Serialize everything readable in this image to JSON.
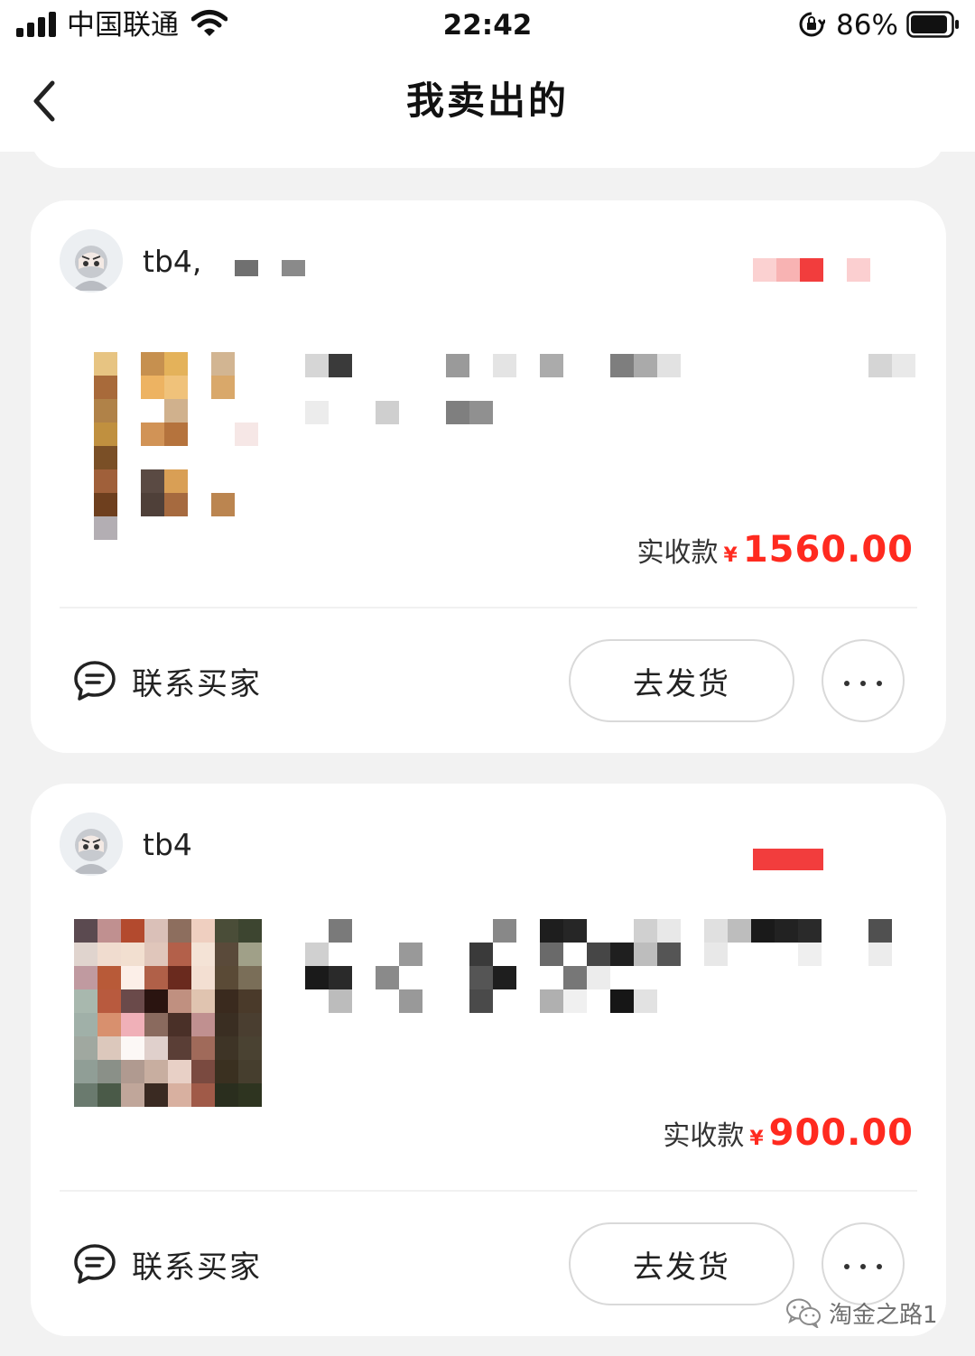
{
  "status_bar": {
    "carrier": "中国联通",
    "time": "22:42",
    "battery_percent": "86%"
  },
  "nav": {
    "title": "我卖出的"
  },
  "orders": [
    {
      "buyer_name": "tb4,",
      "price_label": "实收款",
      "currency": "¥",
      "amount": "1560.00",
      "contact_label": "联系买家",
      "ship_label": "去发货"
    },
    {
      "buyer_name": "tb4",
      "price_label": "实收款",
      "currency": "¥",
      "amount": "900.00",
      "contact_label": "联系买家",
      "ship_label": "去发货"
    }
  ],
  "watermark": {
    "text": "淘金之路1"
  },
  "colors": {
    "accent": "#ff2a1f",
    "background": "#f2f2f2",
    "card": "#ffffff"
  },
  "icons": {
    "back": "chevron-left-icon",
    "contact": "chat-bubble-icon",
    "more": "more-dots-icon"
  }
}
